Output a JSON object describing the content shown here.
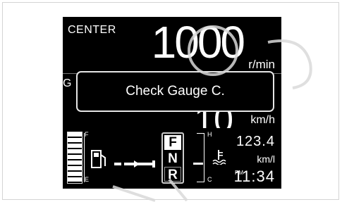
{
  "display": {
    "mode_label": "CENTER",
    "rpm": {
      "value": "1000",
      "unit": "r/min"
    },
    "hidden_left_char": "G",
    "speed": {
      "value": "10",
      "unit": "km/h"
    },
    "popup": {
      "message": "Check Gauge C."
    },
    "fuel": {
      "full_label": "F",
      "empty_label": "E",
      "level": 1.0
    },
    "temperature": {
      "hot_label": "H",
      "cold_label": "C",
      "level": 0.4
    },
    "gear": {
      "options": [
        "F",
        "N",
        "R"
      ],
      "selected": "F"
    },
    "mileage": {
      "value": "123.4",
      "unit": "km/l"
    },
    "clock": {
      "ampm": "PM",
      "time": "11:34"
    }
  },
  "colors": {
    "screen_bg": "#000000",
    "text": "#ffffff",
    "watermark": "#d9d9d9"
  }
}
